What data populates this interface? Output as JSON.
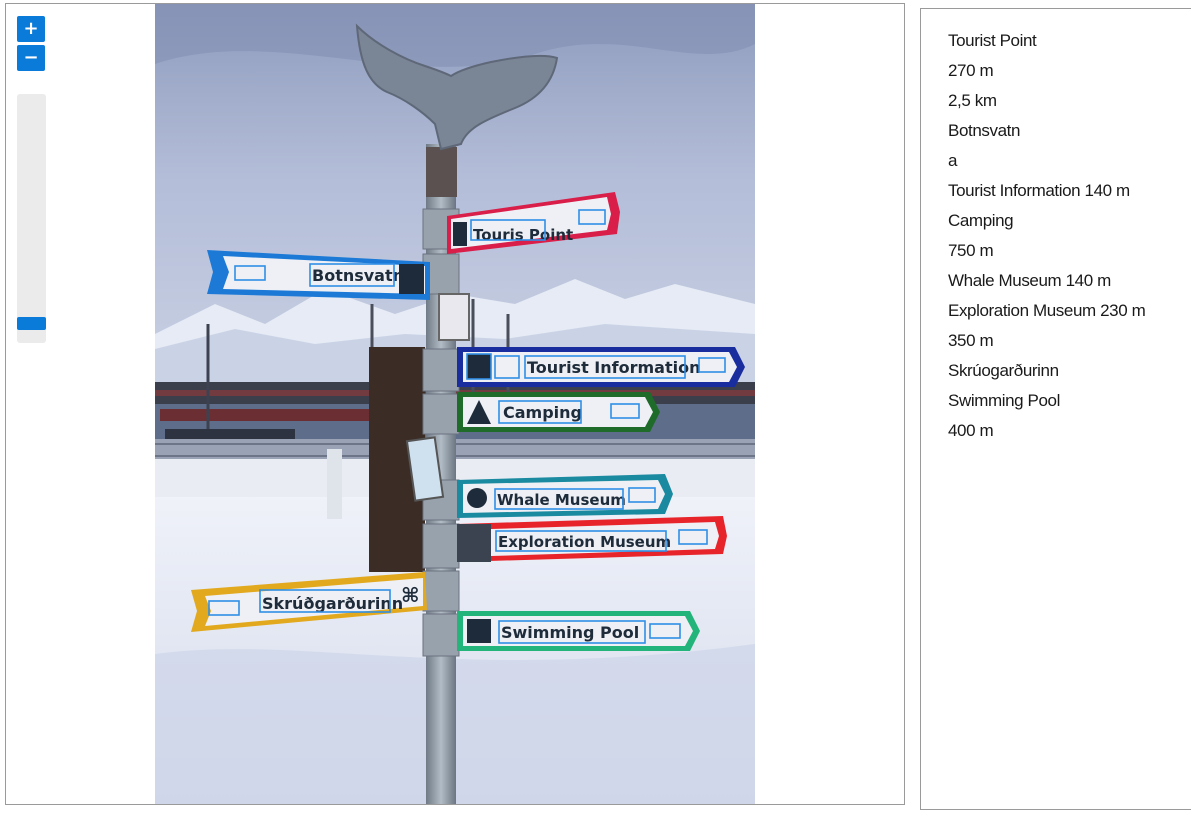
{
  "viewer": {
    "zoom_in_label": "+",
    "zoom_out_label": "−",
    "zoom_level_fraction": 0.06
  },
  "photo": {
    "signs": {
      "tourist_point": "Touris Point",
      "botnsvatn": "Botnsvatn",
      "tourist_information": "Tourist Information",
      "camping": "Camping",
      "whale_museum": "Whale Museum",
      "exploration_museum": "Exploration Museum",
      "skruogardurinn": "Skrúðgarðurinn",
      "swimming_pool": "Swimming Pool"
    },
    "colors": {
      "sky": "#a9b5d2",
      "snow": "#e8ecf5",
      "pole": "#8f9aa6",
      "red_sign": "#d81e49",
      "blue_sign": "#1c7ad6",
      "navy_sign": "#1a2d9e",
      "green_sign": "#1f6b2a",
      "teal_sign": "#1a8aa0",
      "red2_sign": "#e8242b",
      "yellow_sign": "#e2a91e",
      "mint_sign": "#22b47a",
      "ocr_box": "#2f8fe6"
    }
  },
  "results": [
    "Tourist Point",
    "270 m",
    "2,5 km",
    "Botnsvatn",
    "a",
    "Tourist Information 140 m",
    "Camping",
    "750 m",
    "Whale Museum 140 m",
    "Exploration Museum 230 m",
    "350 m",
    "Skrúogarðurinn",
    "Swimming Pool",
    "400 m"
  ]
}
